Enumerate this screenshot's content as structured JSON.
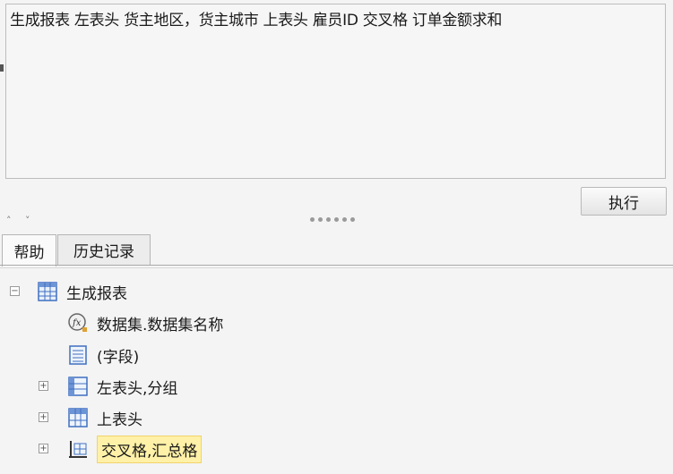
{
  "query": {
    "text": "生成报表 左表头 货主地区，货主城市 上表头 雇员ID 交叉格 订单金额求和"
  },
  "toolbar": {
    "run_label": "执行"
  },
  "tabs": [
    {
      "label": "帮助",
      "active": true
    },
    {
      "label": "历史记录",
      "active": false
    }
  ],
  "tree": {
    "root": {
      "label": "生成报表",
      "icon": "table-grid-icon",
      "expander": "⊟"
    },
    "children": [
      {
        "label": "数据集.数据集名称",
        "icon": "fx-function-icon"
      },
      {
        "label": "(字段)",
        "icon": "field-list-icon"
      },
      {
        "label": "左表头,分组",
        "icon": "left-header-icon",
        "expander": "⊞"
      },
      {
        "label": "上表头",
        "icon": "top-header-icon",
        "expander": "⊞"
      },
      {
        "label": "交叉格,汇总格",
        "icon": "cross-cell-icon",
        "expander": "⊞",
        "selected": true
      }
    ]
  },
  "colors": {
    "highlight": "#fff1a8",
    "icon_blue": "#3f6fc0"
  }
}
